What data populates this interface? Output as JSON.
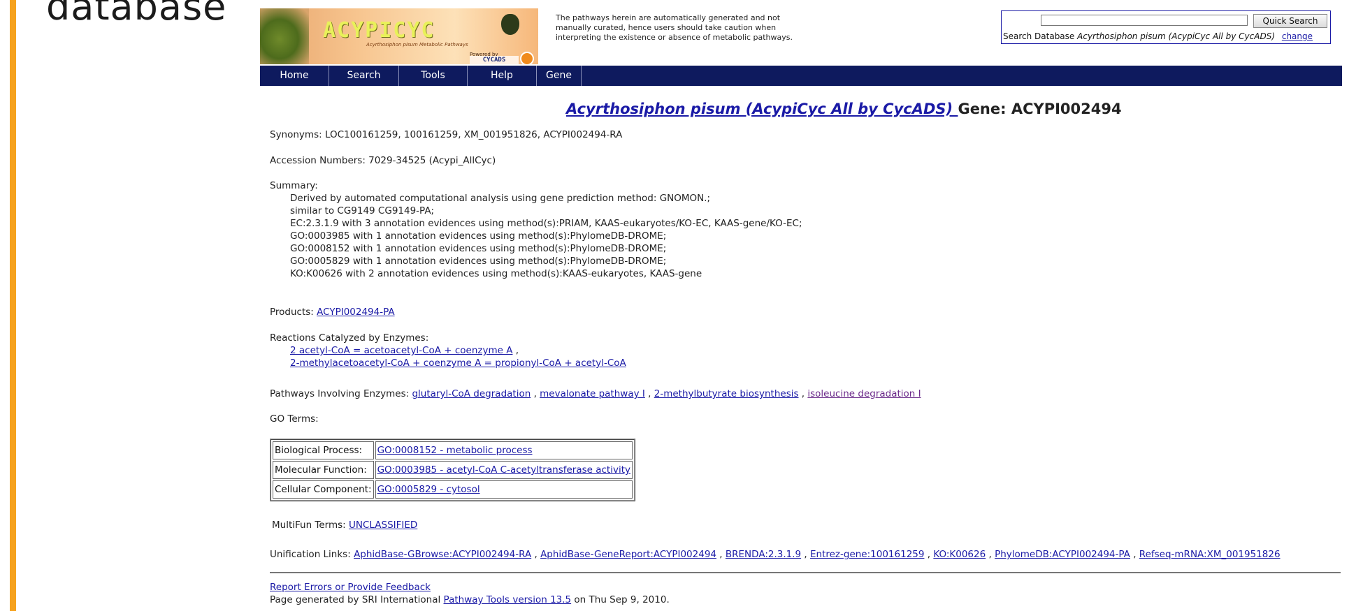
{
  "slide_fragment": {
    "word": "database"
  },
  "header": {
    "logo": {
      "brand": "ACYPICYC",
      "subtitle": "Acyrthosiphon pisum Metabolic Pathways",
      "powered_by": "Powered by",
      "cycads": "CYCADS"
    },
    "disclaimer": "The pathways herein are automatically generated and not manually curated, hence users should take caution when interpreting the existence or absence of metabolic pathways.",
    "quick_search": {
      "input_value": "",
      "button_label": "Quick Search",
      "db_prefix": "Search Database",
      "db_name": "Acyrthosiphon pisum (AcypiCyc All by CycADS)",
      "change_label": "change"
    }
  },
  "nav": {
    "items": [
      "Home",
      "Search",
      "Tools",
      "Help",
      "Gene"
    ]
  },
  "page": {
    "title_link": "Acyrthosiphon pisum (AcypiCyc All by CycADS) ",
    "title_rest": "Gene: ACYPI002494",
    "synonyms": "Synonyms: LOC100161259, 100161259, XM_001951826, ACYPI002494-RA",
    "accession": "Accession Numbers: 7029-34525 (Acypi_AllCyc)",
    "summary_label": "Summary:",
    "summary_lines": [
      "Derived by automated computational analysis using gene prediction method: GNOMON.;",
      "similar to CG9149 CG9149-PA;",
      "EC:2.3.1.9 with 3 annotation evidences using method(s):PRIAM, KAAS-eukaryotes/KO-EC, KAAS-gene/KO-EC;",
      "GO:0003985 with 1 annotation evidences using method(s):PhylomeDB-DROME;",
      "GO:0008152 with 1 annotation evidences using method(s):PhylomeDB-DROME;",
      "GO:0005829 with 1 annotation evidences using method(s):PhylomeDB-DROME;",
      "KO:K00626 with 2 annotation evidences using method(s):KAAS-eukaryotes, KAAS-gene"
    ],
    "products_label": "Products:",
    "products_link": "ACYPI002494-PA",
    "reactions_label": "Reactions Catalyzed by Enzymes:",
    "reactions": [
      "2 acetyl-CoA = acetoacetyl-CoA + coenzyme A",
      "2-methylacetoacetyl-CoA + coenzyme A = propionyl-CoA + acetyl-CoA"
    ],
    "pathways_label": "Pathways Involving Enzymes:",
    "pathways": [
      "glutaryl-CoA degradation",
      "mevalonate pathway I",
      "2-methylbutyrate biosynthesis",
      "isoleucine degradation I"
    ],
    "go_label": "GO Terms:",
    "go_terms": [
      {
        "category": "Biological Process:",
        "term": "GO:0008152 - metabolic process"
      },
      {
        "category": "Molecular Function:",
        "term": "GO:0003985 - acetyl-CoA C-acetyltransferase activity"
      },
      {
        "category": "Cellular Component:",
        "term": "GO:0005829 - cytosol"
      }
    ],
    "multifun_label": "MultiFun Terms:",
    "multifun_link": "UNCLASSIFIED",
    "unification_label": "Unification Links:",
    "unification_links": [
      "AphidBase-GBrowse:ACYPI002494-RA",
      "AphidBase-GeneReport:ACYPI002494",
      "BRENDA:2.3.1.9",
      "Entrez-gene:100161259",
      "KO:K00626",
      "PhylomeDB:ACYPI002494-PA",
      "Refseq-mRNA:XM_001951826"
    ],
    "footer_feedback": "Report Errors or Provide Feedback",
    "footer_prefix": "Page generated by SRI International",
    "footer_link": "Pathway Tools version 13.5",
    "footer_suffix": "on Thu Sep 9, 2010."
  },
  "colors": {
    "nav_bg": "#0e1a5e",
    "link": "#1a1aa6",
    "visited": "#6b2a8a",
    "accent_orange": "#f6a21e"
  }
}
